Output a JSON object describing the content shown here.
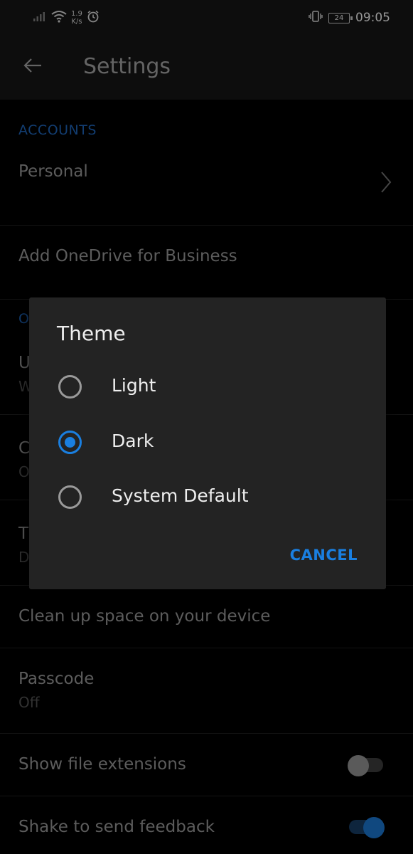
{
  "status_bar": {
    "net_speed_value": "1.9",
    "net_speed_unit": "K/s",
    "battery": "24",
    "time": "09:05"
  },
  "app_bar": {
    "title": "Settings"
  },
  "sections": {
    "accounts_header": "ACCOUNTS",
    "other_header_visible": "O"
  },
  "rows": {
    "personal": "Personal",
    "add_business": "Add OneDrive for Business",
    "hidden_1_title": "U",
    "hidden_1_sub": "W",
    "hidden_2_title": "C",
    "hidden_2_sub": "O",
    "hidden_3_title": "T",
    "hidden_3_sub": "D",
    "clean_up": "Clean up space on your device",
    "passcode_title": "Passcode",
    "passcode_sub": "Off",
    "show_ext": "Show file extensions",
    "shake": "Shake to send feedback"
  },
  "toggles": {
    "show_ext_on": false,
    "shake_on": true
  },
  "dialog": {
    "title": "Theme",
    "options": [
      "Light",
      "Dark",
      "System Default"
    ],
    "selected": "Dark",
    "cancel": "CANCEL"
  },
  "colors": {
    "accent": "#1a7fe0",
    "section_header": "#1d5fae",
    "dialog_bg": "#232323"
  },
  "icons": {
    "back": "arrow-left-icon",
    "chevron": "chevron-right-icon",
    "wifi": "wifi-icon",
    "signal": "signal-icon",
    "alarm": "alarm-icon",
    "vibrate": "vibrate-icon"
  }
}
